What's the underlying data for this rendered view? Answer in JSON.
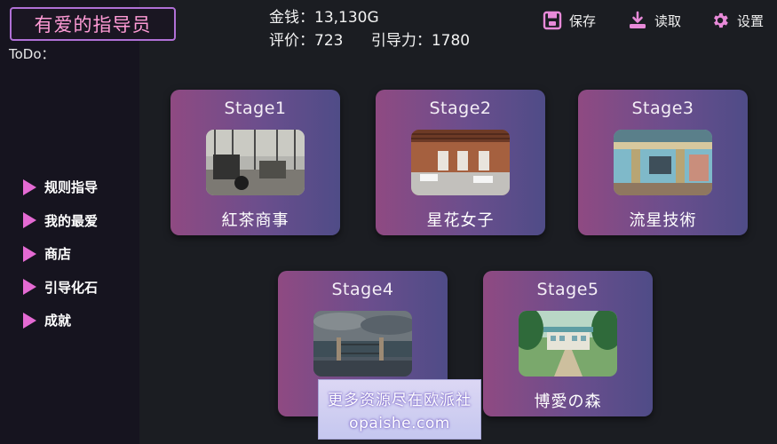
{
  "game": {
    "title": "有爱的指导员",
    "todo_label": "ToDo："
  },
  "stats": {
    "money": "金钱：13,130G",
    "rating": "评价：723",
    "guidance": "引导力：1780"
  },
  "top_buttons": {
    "save": "保存",
    "load": "读取",
    "settings": "设置"
  },
  "menu": {
    "items": [
      {
        "label": "规则指导"
      },
      {
        "label": "我的最爱"
      },
      {
        "label": "商店"
      },
      {
        "label": "引导化石"
      },
      {
        "label": "成就"
      }
    ]
  },
  "stages": [
    {
      "stage": "Stage1",
      "name": "紅茶商事"
    },
    {
      "stage": "Stage2",
      "name": "星花女子"
    },
    {
      "stage": "Stage3",
      "name": "流星技術"
    },
    {
      "stage": "Stage4",
      "name": ""
    },
    {
      "stage": "Stage5",
      "name": "博愛の森"
    }
  ],
  "watermark": {
    "line1": "更多资源尽在欧派社",
    "line2": "opaishe.com"
  },
  "colors": {
    "accent_pink": "#e46ad3",
    "title_text": "#ff9bd6",
    "title_border": "#b070d6",
    "card_gradient_start": "#8f4a82",
    "card_gradient_end": "#4f4c87",
    "background": "#1b1d22",
    "sidebar": "#16141f"
  }
}
